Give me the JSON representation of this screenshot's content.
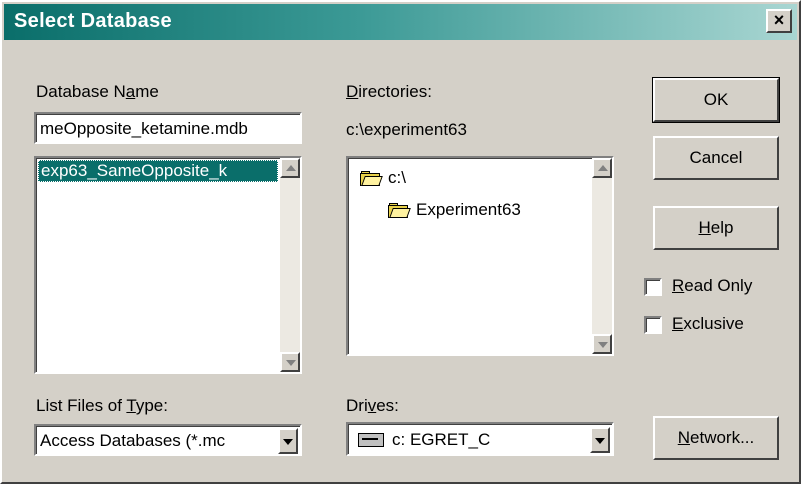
{
  "window": {
    "title": "Select Database"
  },
  "db_name": {
    "label_before": "Database N",
    "label_key": "a",
    "label_after": "me",
    "value": "meOpposite_ketamine.mdb",
    "list_items": [
      "exp63_SameOpposite_k"
    ]
  },
  "directories": {
    "label_key": "D",
    "label_after": "irectories:",
    "current_path": "c:\\experiment63",
    "tree": [
      "c:\\",
      "Experiment63"
    ]
  },
  "file_type": {
    "label_before": "List Files of ",
    "label_key": "T",
    "label_after": "ype:",
    "selected": "Access Databases (*.mc"
  },
  "drives": {
    "label_before": "Dri",
    "label_key": "v",
    "label_after": "es:",
    "selected": "c: EGRET_C"
  },
  "buttons": {
    "ok": "OK",
    "cancel": "Cancel",
    "help_key": "H",
    "help_rest": "elp",
    "network_key": "N",
    "network_rest": "etwork..."
  },
  "options": {
    "read_only_key": "R",
    "read_only_rest": "ead Only",
    "exclusive_key": "E",
    "exclusive_rest": "xclusive"
  }
}
